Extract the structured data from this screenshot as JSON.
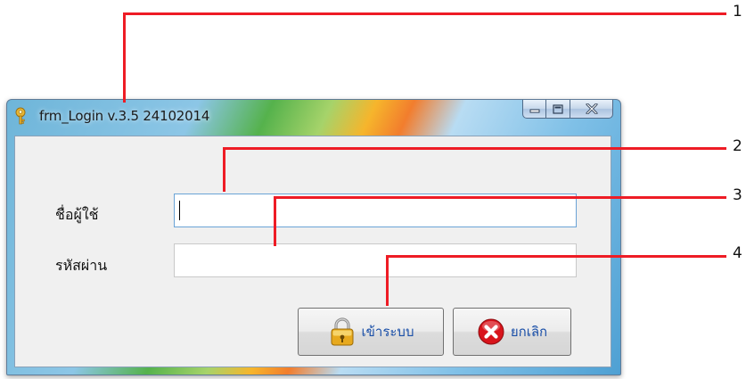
{
  "window": {
    "title": "frm_Login v.3.5 24102014",
    "icon": "key-icon",
    "controls": [
      "minimize-icon",
      "maximize-icon",
      "close-icon"
    ]
  },
  "form": {
    "username_label": "ชื่อผู้ใช้",
    "username_value": "",
    "password_label": "รหัสผ่าน",
    "password_value": ""
  },
  "buttons": {
    "login_label": "เข้าระบบ",
    "login_icon": "padlock-icon",
    "cancel_label": "ยกเลิก",
    "cancel_icon": "red-x-circle-icon"
  },
  "annotations": [
    "1",
    "2",
    "3",
    "4"
  ],
  "colors": {
    "annotation_line": "#ee1c25",
    "button_text": "#1a4fa8"
  }
}
